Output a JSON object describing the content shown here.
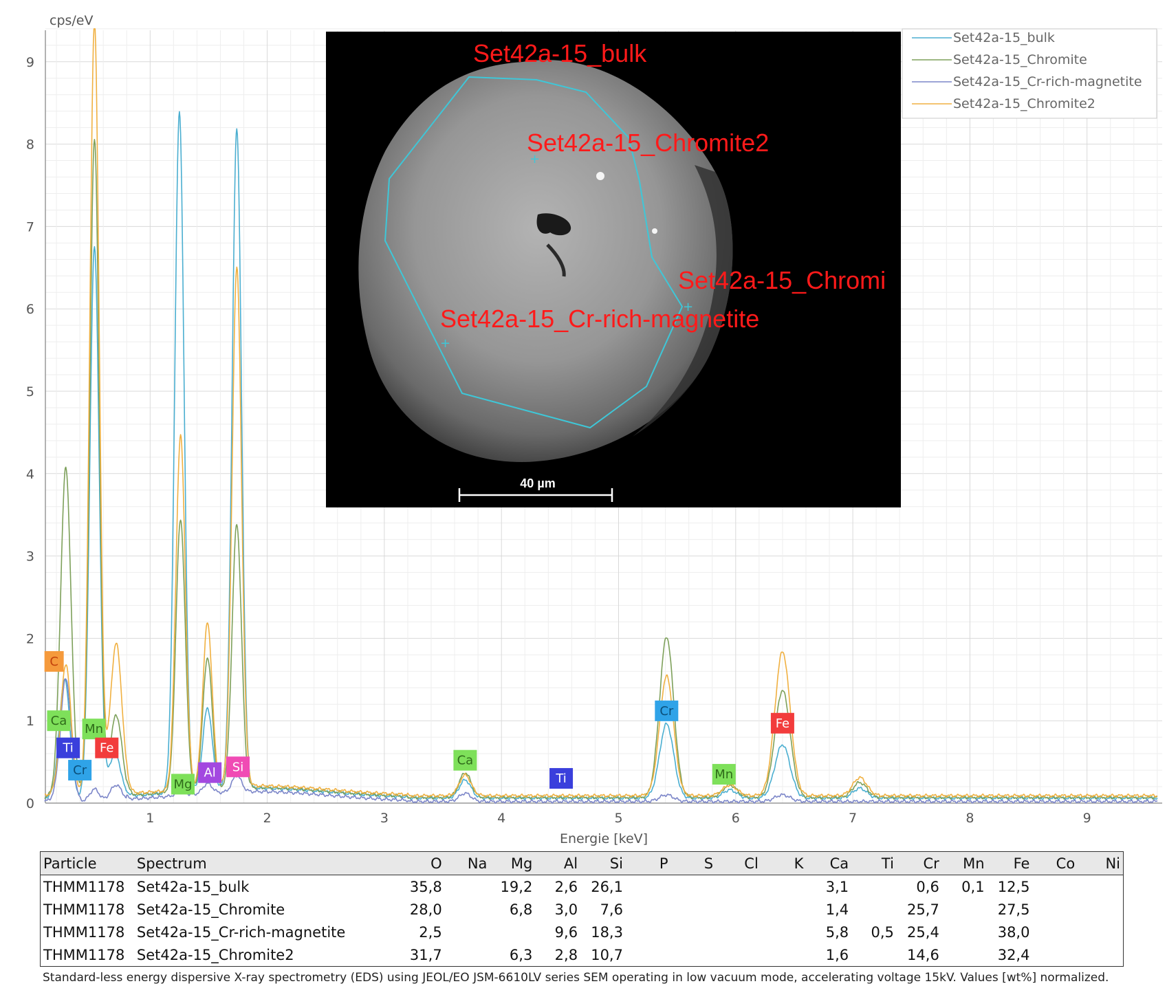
{
  "chart_data": {
    "type": "line",
    "title": "",
    "xlabel": "Energie [keV]",
    "ylabel": "cps/eV",
    "xlim": [
      0,
      9.6
    ],
    "ylim": [
      0,
      9.4
    ],
    "xticks": [
      1,
      2,
      3,
      4,
      5,
      6,
      7,
      8,
      9
    ],
    "yticks": [
      0,
      1,
      2,
      3,
      4,
      5,
      6,
      7,
      8,
      9
    ],
    "grid": true,
    "legend_position": "top-right",
    "series": [
      {
        "name": "Set42a-15_bulk",
        "color": "#4aaed0",
        "baseline": 0.06,
        "peaks": [
          [
            0.27,
            1.45,
            0.045
          ],
          [
            0.525,
            6.7,
            0.04
          ],
          [
            0.7,
            0.55,
            0.05
          ],
          [
            1.25,
            8.25,
            0.04
          ],
          [
            1.49,
            1.0,
            0.04
          ],
          [
            1.74,
            8.0,
            0.04
          ],
          [
            3.69,
            0.22,
            0.05
          ],
          [
            5.41,
            0.9,
            0.06
          ],
          [
            5.95,
            0.1,
            0.06
          ],
          [
            6.4,
            0.65,
            0.065
          ],
          [
            7.06,
            0.12,
            0.06
          ]
        ]
      },
      {
        "name": "Set42a-15_Chromite",
        "color": "#7da05a",
        "baseline": 0.07,
        "peaks": [
          [
            0.28,
            4.0,
            0.045
          ],
          [
            0.525,
            8.0,
            0.04
          ],
          [
            0.71,
            1.0,
            0.05
          ],
          [
            1.26,
            3.3,
            0.04
          ],
          [
            1.49,
            1.6,
            0.04
          ],
          [
            1.74,
            3.2,
            0.04
          ],
          [
            3.69,
            0.3,
            0.05
          ],
          [
            5.41,
            1.95,
            0.06
          ],
          [
            5.95,
            0.15,
            0.06
          ],
          [
            6.4,
            1.3,
            0.065
          ],
          [
            7.06,
            0.18,
            0.06
          ]
        ]
      },
      {
        "name": "Set42a-15_Cr-rich-magnetite",
        "color": "#7b85c8",
        "baseline": 0.02,
        "peaks": [
          [
            0.28,
            1.5,
            0.045
          ],
          [
            0.525,
            0.15,
            0.04
          ],
          [
            0.71,
            0.2,
            0.05
          ],
          [
            1.26,
            0.05,
            0.04
          ],
          [
            1.49,
            0.12,
            0.04
          ],
          [
            1.74,
            0.2,
            0.04
          ],
          [
            3.69,
            0.1,
            0.05
          ],
          [
            5.41,
            0.08,
            0.06
          ],
          [
            6.4,
            0.08,
            0.065
          ]
        ]
      },
      {
        "name": "Set42a-15_Chromite2",
        "color": "#f0b040",
        "baseline": 0.09,
        "peaks": [
          [
            0.28,
            1.6,
            0.045
          ],
          [
            0.525,
            9.4,
            0.04
          ],
          [
            0.71,
            1.85,
            0.05
          ],
          [
            1.26,
            4.3,
            0.04
          ],
          [
            1.49,
            2.0,
            0.04
          ],
          [
            1.74,
            6.3,
            0.04
          ],
          [
            3.69,
            0.25,
            0.05
          ],
          [
            5.41,
            1.45,
            0.06
          ],
          [
            5.95,
            0.13,
            0.06
          ],
          [
            6.4,
            1.75,
            0.065
          ],
          [
            7.06,
            0.22,
            0.06
          ]
        ]
      }
    ],
    "element_markers": [
      {
        "label": "C",
        "x": 0.18,
        "y": 1.72,
        "color": "#f59a3c",
        "text_color": "#c2410c"
      },
      {
        "label": "Ca",
        "x": 0.22,
        "y": 1.0,
        "color": "#7ee05a",
        "text_color": "#2f6b1a"
      },
      {
        "label": "Mn",
        "x": 0.52,
        "y": 0.9,
        "color": "#7ee05a",
        "text_color": "#2f6b1a"
      },
      {
        "label": "Ti",
        "x": 0.3,
        "y": 0.67,
        "color": "#3a3fdc",
        "text_color": "#ffffff"
      },
      {
        "label": "Fe",
        "x": 0.63,
        "y": 0.67,
        "color": "#f23c3c",
        "text_color": "#ffffff"
      },
      {
        "label": "Cr",
        "x": 0.4,
        "y": 0.4,
        "color": "#2fa3e8",
        "text_color": "#0b4f7a"
      },
      {
        "label": "Mg",
        "x": 1.28,
        "y": 0.23,
        "color": "#7ee05a",
        "text_color": "#2f6b1a"
      },
      {
        "label": "Al",
        "x": 1.51,
        "y": 0.37,
        "color": "#a348e0",
        "text_color": "#ffffff"
      },
      {
        "label": "Si",
        "x": 1.75,
        "y": 0.44,
        "color": "#f04bb4",
        "text_color": "#ffffff"
      },
      {
        "label": "Ca",
        "x": 3.69,
        "y": 0.52,
        "color": "#7ee05a",
        "text_color": "#2f6b1a"
      },
      {
        "label": "Ti",
        "x": 4.51,
        "y": 0.3,
        "color": "#3a3fdc",
        "text_color": "#ffffff"
      },
      {
        "label": "Cr",
        "x": 5.41,
        "y": 1.12,
        "color": "#2fa3e8",
        "text_color": "#0b4f7a"
      },
      {
        "label": "Mn",
        "x": 5.9,
        "y": 0.35,
        "color": "#7ee05a",
        "text_color": "#2f6b1a"
      },
      {
        "label": "Fe",
        "x": 6.4,
        "y": 0.97,
        "color": "#f23c3c",
        "text_color": "#ffffff"
      }
    ]
  },
  "sem_inset": {
    "labels": [
      "Set42a-15_bulk",
      "Set42a-15_Chromite2",
      "Set42a-15_Chromi",
      "Set42a-15_Cr-rich-magnetite"
    ],
    "scale_bar": "40 µm"
  },
  "table": {
    "headers": [
      "Particle",
      "Spectrum",
      "O",
      "Na",
      "Mg",
      "Al",
      "Si",
      "P",
      "S",
      "Cl",
      "K",
      "Ca",
      "Ti",
      "Cr",
      "Mn",
      "Fe",
      "Co",
      "Ni"
    ],
    "rows": [
      [
        "THMM1178",
        "Set42a-15_bulk",
        "35,8",
        "",
        "19,2",
        "2,6",
        "26,1",
        "",
        "",
        "",
        "",
        "3,1",
        "",
        "0,6",
        "0,1",
        "12,5",
        "",
        ""
      ],
      [
        "THMM1178",
        "Set42a-15_Chromite",
        "28,0",
        "",
        "6,8",
        "3,0",
        "7,6",
        "",
        "",
        "",
        "",
        "1,4",
        "",
        "25,7",
        "",
        "27,5",
        "",
        ""
      ],
      [
        "THMM1178",
        "Set42a-15_Cr-rich-magnetite",
        "2,5",
        "",
        "",
        "9,6",
        "18,3",
        "",
        "",
        "",
        "",
        "5,8",
        "0,5",
        "25,4",
        "",
        "38,0",
        "",
        ""
      ],
      [
        "THMM1178",
        "Set42a-15_Chromite2",
        "31,7",
        "",
        "6,3",
        "2,8",
        "10,7",
        "",
        "",
        "",
        "",
        "1,6",
        "",
        "14,6",
        "",
        "32,4",
        "",
        ""
      ]
    ]
  },
  "caption": "Standard-less energy dispersive X-ray spectrometry (EDS) using JEOL/EO JSM-6610LV series SEM operating in low vacuum mode, accelerating voltage 15kV. Values [wt%] normalized."
}
